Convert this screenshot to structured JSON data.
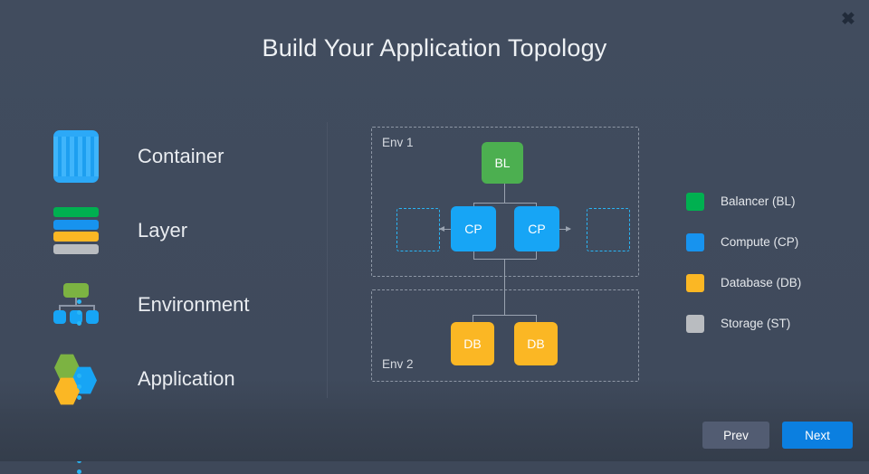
{
  "window": {
    "title": "Build Your Application Topology",
    "close_icon": "close-icon",
    "close_glyph": "✖"
  },
  "concepts": [
    {
      "label": "Container",
      "icon": "container-icon"
    },
    {
      "label": "Layer",
      "icon": "layer-icon"
    },
    {
      "label": "Environment",
      "icon": "environment-icon"
    },
    {
      "label": "Application",
      "icon": "application-icon"
    }
  ],
  "layer_icon_colors": [
    "#00b050",
    "#1793ef",
    "#fbb724",
    "#b9bcc0"
  ],
  "topology": {
    "environments": [
      {
        "name": "Env 1"
      },
      {
        "name": "Env 2"
      }
    ],
    "nodes": [
      {
        "id": "bl",
        "label": "BL",
        "type": "balancer",
        "color": "#4caf50",
        "env": "Env 1"
      },
      {
        "id": "cp-l",
        "label": "CP",
        "type": "compute",
        "color": "#17a5f5",
        "env": "Env 1"
      },
      {
        "id": "cp-r",
        "label": "CP",
        "type": "compute",
        "color": "#17a5f5",
        "env": "Env 1"
      },
      {
        "id": "db-l",
        "label": "DB",
        "type": "database",
        "color": "#fbb724",
        "env": "Env 2"
      },
      {
        "id": "db-r",
        "label": "DB",
        "type": "database",
        "color": "#fbb724",
        "env": "Env 2"
      }
    ],
    "placeholders": [
      {
        "id": "slot-left",
        "side": "left",
        "arrow": "←"
      },
      {
        "id": "slot-right",
        "side": "right",
        "arrow": "→"
      }
    ]
  },
  "legend": {
    "items": [
      {
        "label": "Balancer (BL)",
        "color": "#00b050"
      },
      {
        "label": "Compute (CP)",
        "color": "#1793ef"
      },
      {
        "label": "Database (DB)",
        "color": "#fbb724"
      },
      {
        "label": "Storage (ST)",
        "color": "#b9bcc0"
      }
    ]
  },
  "footer": {
    "prev_label": "Prev",
    "next_label": "Next"
  },
  "theme": {
    "background": "#3e4859",
    "accent": "#0b7fe0",
    "text": "#e8eaed"
  }
}
